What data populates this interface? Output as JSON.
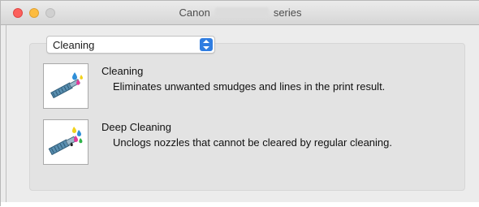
{
  "window": {
    "title_left": "Canon",
    "title_right": "series"
  },
  "dropdown": {
    "selected": "Cleaning"
  },
  "items": [
    {
      "title": "Cleaning",
      "description": "Eliminates unwanted smudges and lines in the print result.",
      "icon": "cleaning-icon"
    },
    {
      "title": "Deep Cleaning",
      "description": "Unclogs nozzles that cannot be cleared by regular cleaning.",
      "icon": "deep-cleaning-icon"
    }
  ],
  "colors": {
    "accent": "#2f7de1",
    "close": "#fc605c",
    "minimize": "#fdbc40"
  }
}
